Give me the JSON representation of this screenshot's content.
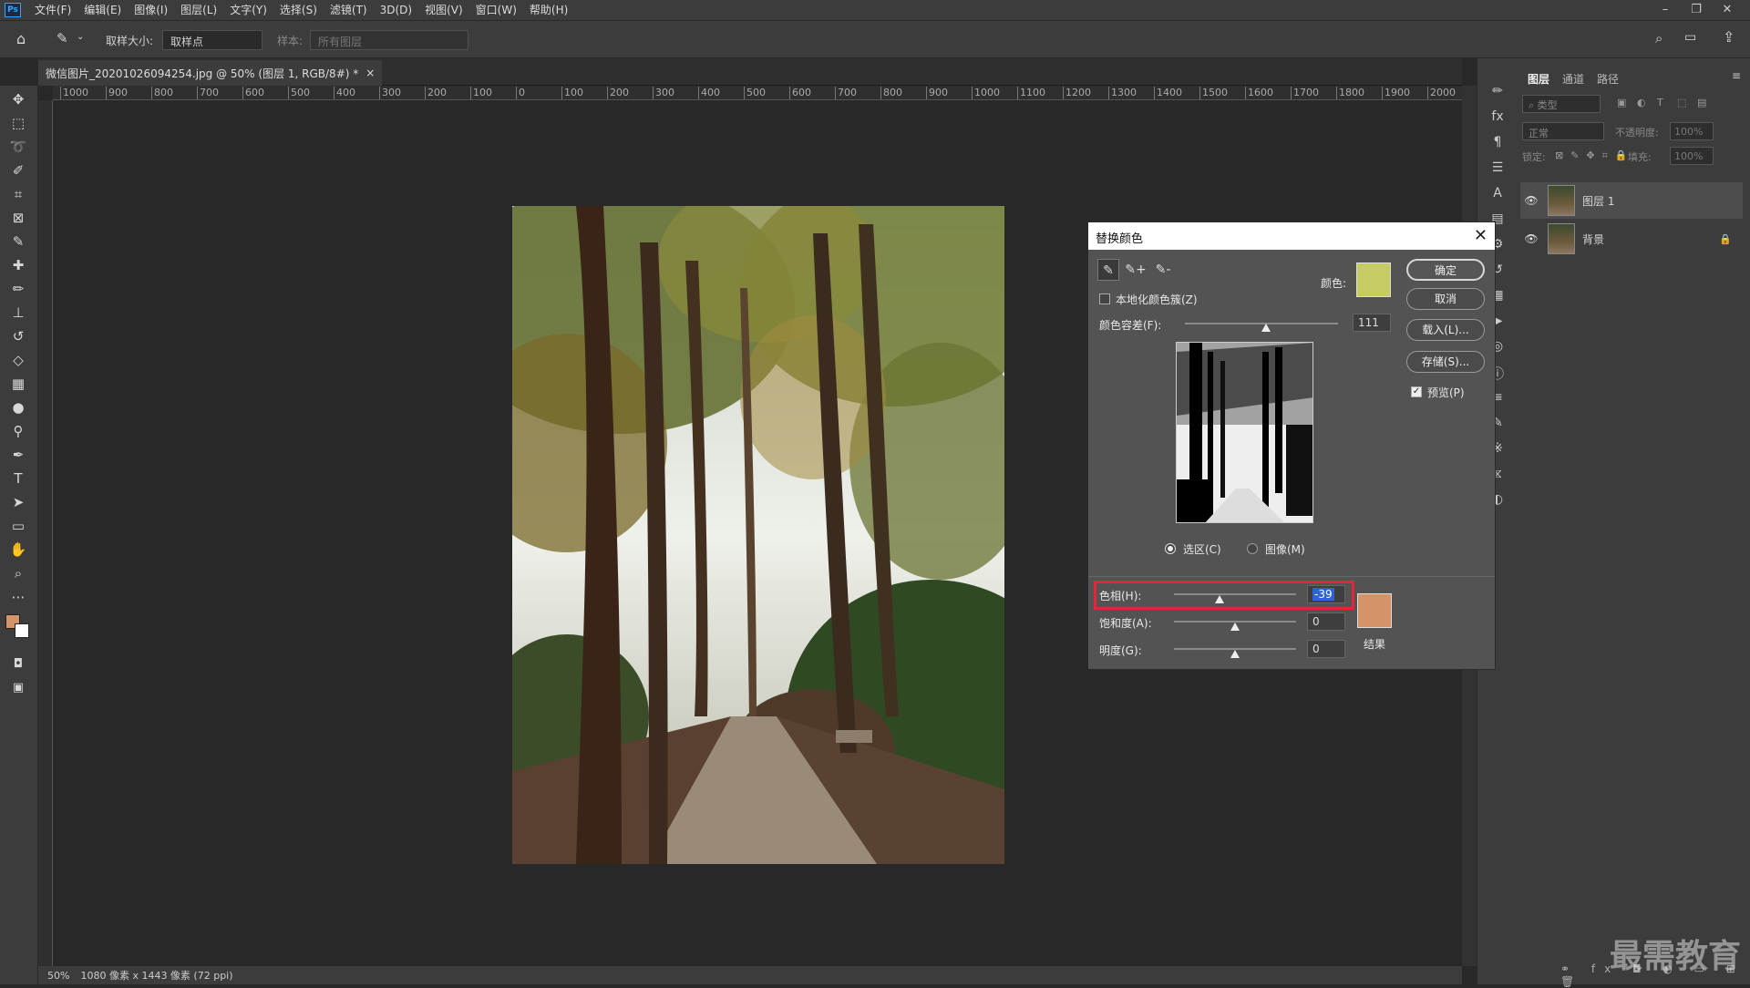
{
  "menu": {
    "items": [
      "文件(F)",
      "编辑(E)",
      "图像(I)",
      "图层(L)",
      "文字(Y)",
      "选择(S)",
      "滤镜(T)",
      "3D(D)",
      "视图(V)",
      "窗口(W)",
      "帮助(H)"
    ]
  },
  "options": {
    "sample_size_label": "取样大小:",
    "sample_size_value": "取样点",
    "sample_label": "样本:",
    "sample_value": "所有图层"
  },
  "document": {
    "tab_title": "微信图片_20201026094254.jpg @ 50% (图层 1, RGB/8#) *",
    "ruler_ticks": [
      "1000",
      "900",
      "800",
      "700",
      "600",
      "500",
      "400",
      "300",
      "200",
      "100",
      "0",
      "100",
      "200",
      "300",
      "400",
      "500",
      "600",
      "700",
      "800",
      "900",
      "1000",
      "1100",
      "1200",
      "1300",
      "1400",
      "1500",
      "1600",
      "1700",
      "1800",
      "1900",
      "2000"
    ]
  },
  "status": {
    "zoom": "50%",
    "info": "1080 像素 x 1443 像素 (72 ppi)"
  },
  "layers_panel": {
    "tabs": [
      "图层",
      "通道",
      "路径"
    ],
    "filter_placeholder": "类型",
    "blend_mode": "正常",
    "opacity_label": "不透明度:",
    "opacity_value": "100%",
    "lock_label": "锁定:",
    "fill_label": "填充:",
    "fill_value": "100%",
    "layers": [
      {
        "name": "图层 1"
      },
      {
        "name": "背景"
      }
    ]
  },
  "dialog": {
    "title": "替换颜色",
    "localized_label": "本地化颜色簇(Z)",
    "color_label": "颜色:",
    "selected_color": "#c5cc63",
    "fuzziness_label": "颜色容差(F):",
    "fuzziness_value": "111",
    "radio_selection": "选区(C)",
    "radio_image": "图像(M)",
    "ok": "确定",
    "cancel": "取消",
    "load": "载入(L)...",
    "save": "存储(S)...",
    "preview": "预览(P)",
    "hue_label": "色相(H):",
    "hue_value": "-39",
    "saturation_label": "饱和度(A):",
    "saturation_value": "0",
    "lightness_label": "明度(G):",
    "lightness_value": "0",
    "result_label": "结果",
    "result_color": "#d49368"
  },
  "watermark": "最需教育"
}
